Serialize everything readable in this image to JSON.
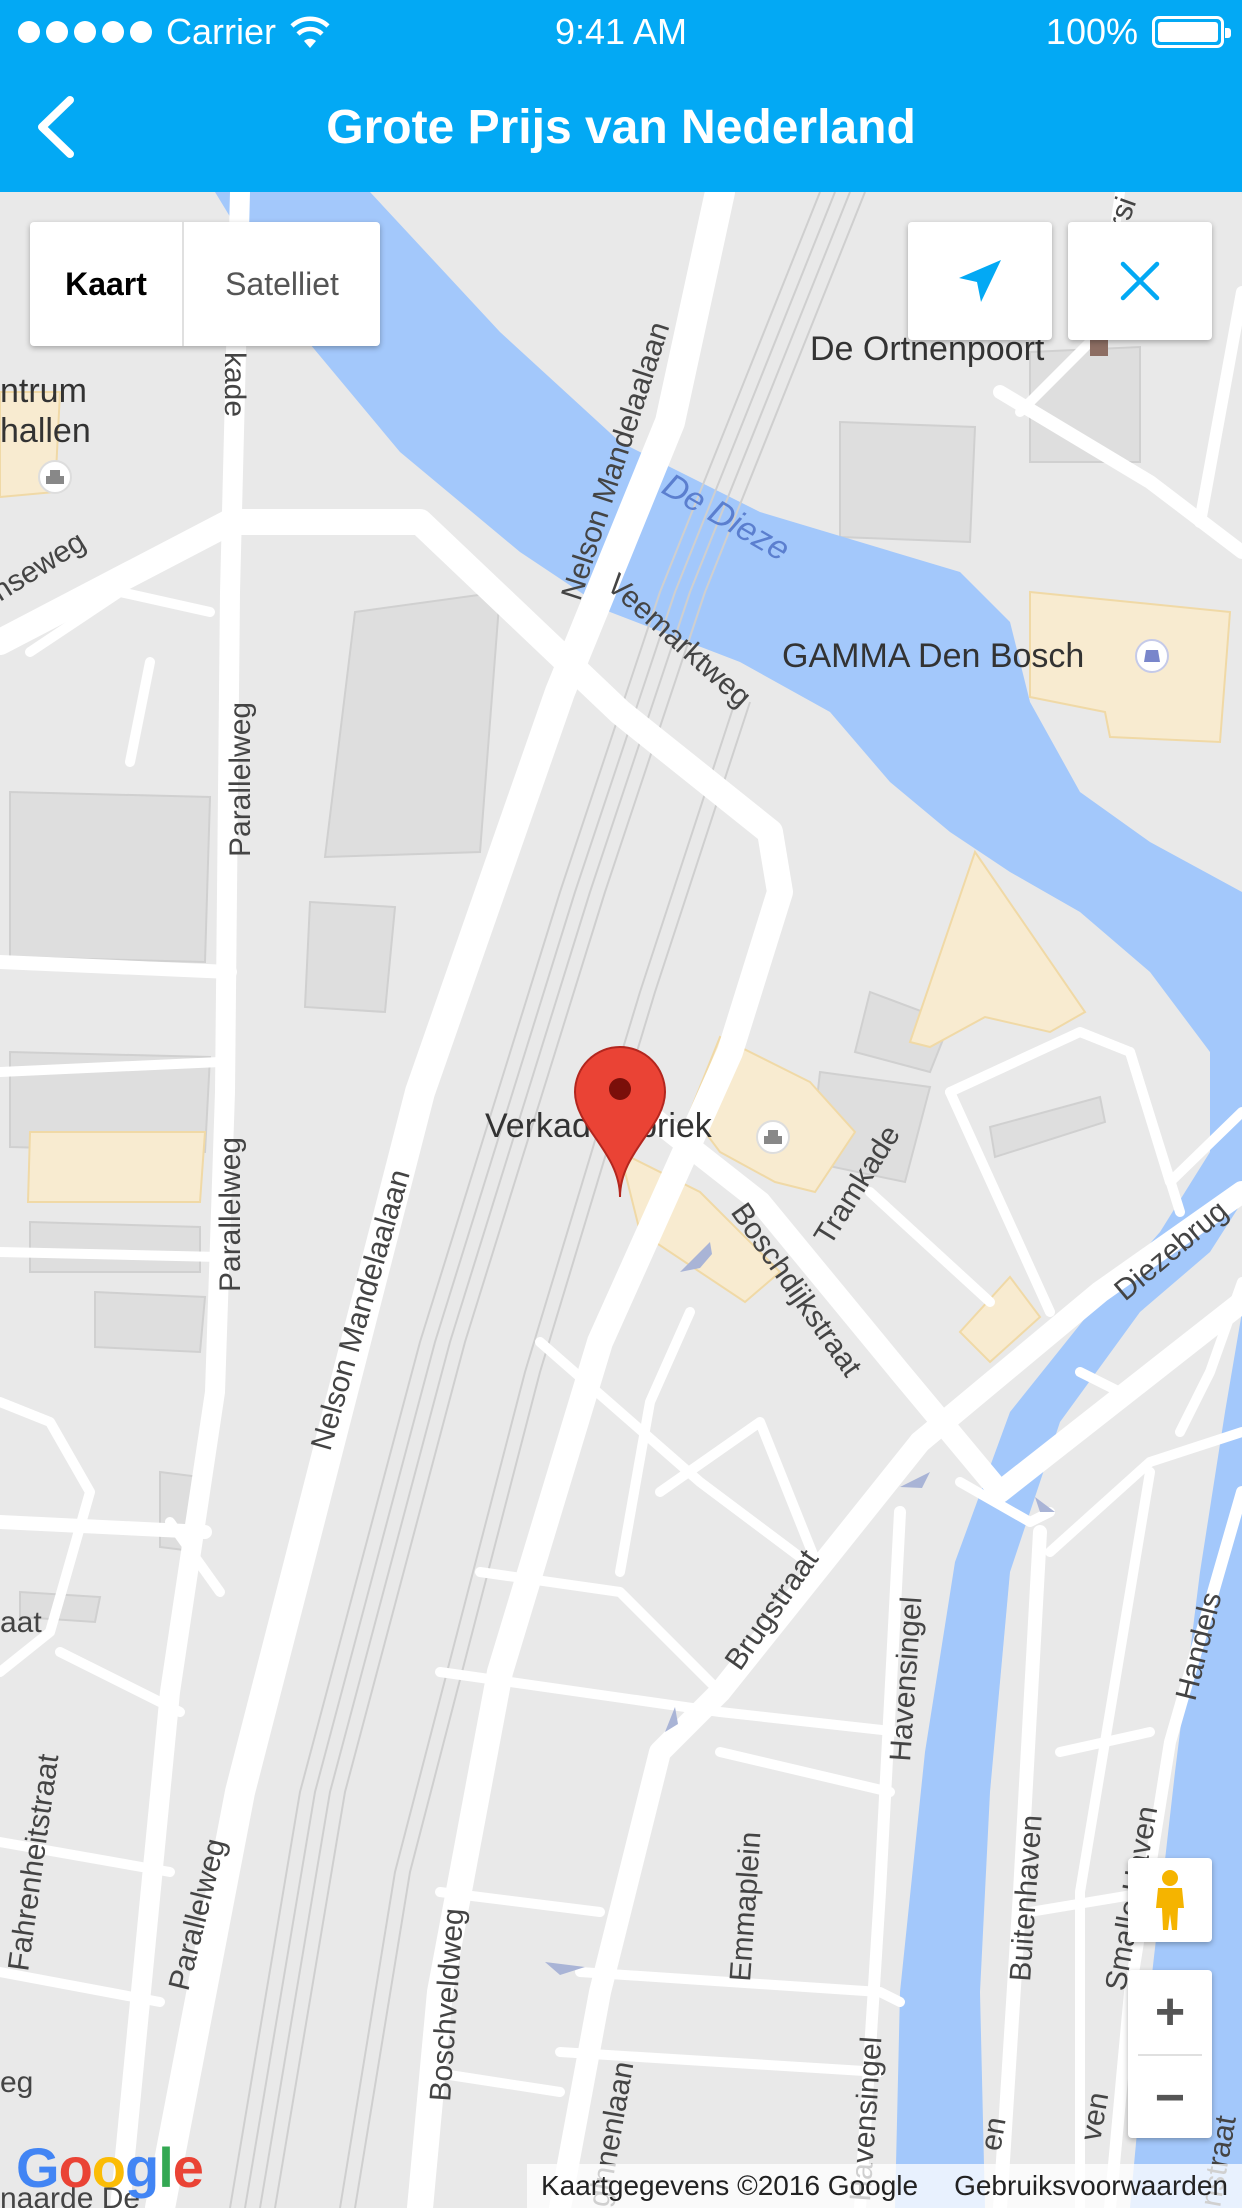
{
  "status_bar": {
    "carrier": "Carrier",
    "time": "9:41 AM",
    "battery": "100%"
  },
  "nav": {
    "title": "Grote Prijs van Nederland",
    "back_icon": "chevron-left-icon"
  },
  "map_controls": {
    "map_type": {
      "selected": "Kaart",
      "other": "Satelliet"
    },
    "location_icon": "navigation-arrow-icon",
    "close_icon": "close-icon",
    "pegman_icon": "street-view-pegman-icon",
    "zoom_in": "+",
    "zoom_out": "−"
  },
  "map": {
    "marker_label": "Verkadefabriek",
    "pois": {
      "ortnenpoort": "De Ortnenpoort",
      "gamma": "GAMMA Den Bosch",
      "centrum_line1": "ntrum",
      "centrum_line2": "hallen"
    },
    "water": {
      "dieze": "De Dieze"
    },
    "streets": {
      "nelson_top": "Nelson Mandelaalaan",
      "nelson_bottom": "Nelson Mandelaalaan",
      "veemarktweg": "Veemarktweg",
      "parallelweg_1": "Parallelweg",
      "parallelweg_2": "Parallelweg",
      "parallelweg_3": "Parallelweg",
      "kade": "kade",
      "seweg": "nseweg",
      "tramkade": "Tramkade",
      "boschdijkstraat": "Boschdijkstraat",
      "diezebrug": "Diezebrug",
      "brugstraat": "Brugstraat",
      "havensingel_1": "Havensingel",
      "havensingel_2": "Havensingel",
      "emmaplein": "Emmaplein",
      "buitenhaven": "Buitenhaven",
      "smalle_haven": "Smalle Haven",
      "handels": "Handels",
      "boschveldweg": "Boschveldweg",
      "ginnenlaan": "ginnenlaan",
      "fahrenheitstraat": "Fahrenheitstraat",
      "aat": "aat",
      "eg": "eg",
      "ven": "ven",
      "en": "en",
      "straat_right": "nstraat",
      "ersi": "ersi",
      "naarde": "naarde De"
    },
    "colors": {
      "water": "#a3c8fb",
      "land": "#e9e9e9",
      "road": "#ffffff",
      "building": "#dcdcdc",
      "poi_area": "#f8ebd0",
      "marker": "#ea4335"
    }
  },
  "attribution": {
    "data": "Kaartgegevens ©2016 Google",
    "terms": "Gebruiksvoorwaarden",
    "logo": "Google"
  }
}
